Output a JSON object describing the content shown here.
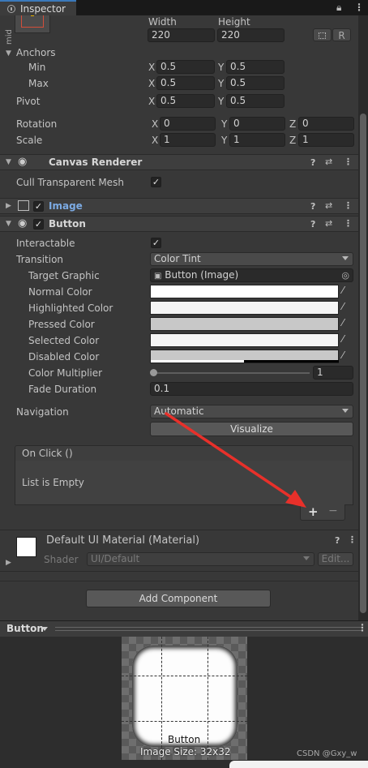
{
  "tab": {
    "title": "Inspector"
  },
  "toolbar": {
    "lock_icon": "lock-icon",
    "menu_icon": "kebab-menu-icon"
  },
  "rect_transform": {
    "anchor_preset_side_label": "mid",
    "width_label": "Width",
    "height_label": "Height",
    "width": "220",
    "height": "220",
    "blueprint_btn": "",
    "raw_btn": "R",
    "anchors_label": "Anchors",
    "min_label": "Min",
    "max_label": "Max",
    "pivot_label": "Pivot",
    "min": {
      "x_label": "X",
      "x": "0.5",
      "y_label": "Y",
      "y": "0.5"
    },
    "max": {
      "x_label": "X",
      "x": "0.5",
      "y_label": "Y",
      "y": "0.5"
    },
    "pivot": {
      "x_label": "X",
      "x": "0.5",
      "y_label": "Y",
      "y": "0.5"
    },
    "rotation_label": "Rotation",
    "rotation": {
      "x_label": "X",
      "x": "0",
      "y_label": "Y",
      "y": "0",
      "z_label": "Z",
      "z": "0"
    },
    "scale_label": "Scale",
    "scale": {
      "x_label": "X",
      "x": "1",
      "y_label": "Y",
      "y": "1",
      "z_label": "Z",
      "z": "1"
    }
  },
  "canvas_renderer": {
    "title": "Canvas Renderer",
    "cull_label": "Cull Transparent Mesh",
    "cull_checked": "✓"
  },
  "image_component": {
    "title": "Image",
    "enabled": "✓",
    "title_color": "#7cabe4"
  },
  "button_component": {
    "title": "Button",
    "enabled": "✓",
    "interactable_label": "Interactable",
    "interactable_checked": "✓",
    "transition_label": "Transition",
    "transition_value": "Color Tint",
    "target_graphic_label": "Target Graphic",
    "target_graphic_value": "Button (Image)",
    "normal_color_label": "Normal Color",
    "normal_color": "#ffffff",
    "highlighted_color_label": "Highlighted Color",
    "highlighted_color": "#f5f5f5",
    "pressed_color_label": "Pressed Color",
    "pressed_color": "#c8c8c8",
    "selected_color_label": "Selected Color",
    "selected_color": "#f5f5f5",
    "disabled_color_label": "Disabled Color",
    "disabled_color": "#c8c8c8",
    "color_multiplier_label": "Color Multiplier",
    "color_multiplier_value": "1",
    "fade_duration_label": "Fade Duration",
    "fade_duration_value": "0.1",
    "navigation_label": "Navigation",
    "navigation_value": "Automatic",
    "visualize_label": "Visualize",
    "on_click_label": "On Click ()",
    "list_empty_label": "List is Empty",
    "add_label": "+",
    "remove_label": "−"
  },
  "material": {
    "title": "Default UI Material (Material)",
    "shader_label": "Shader",
    "shader_value": "UI/Default",
    "edit_label": "Edit..."
  },
  "add_component_label": "Add Component",
  "preview": {
    "dropdown_label": "Button",
    "sprite_name": "Button",
    "image_size": "Image Size: 32x32"
  },
  "watermark": "CSDN @Gxy_w",
  "annotation": {
    "arrow_color": "#e8302a"
  }
}
